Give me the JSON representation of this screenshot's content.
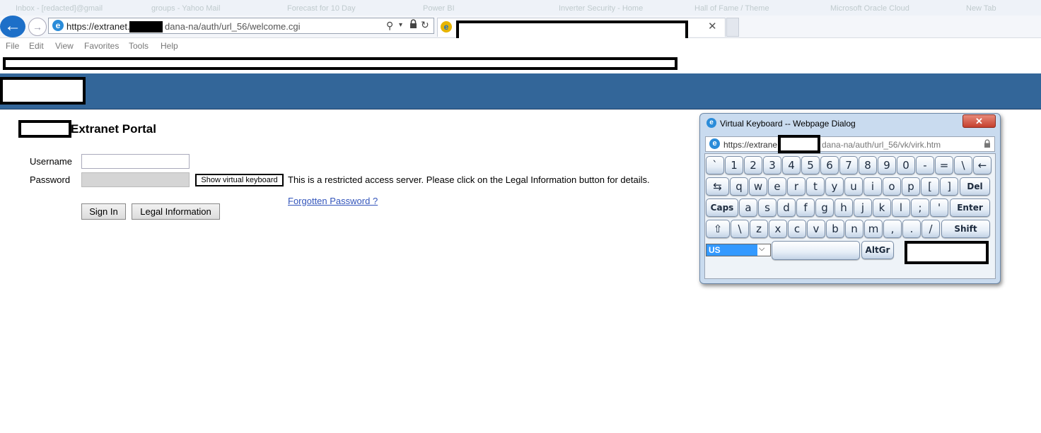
{
  "browser": {
    "faded_tabs": [
      "Inbox - [redacted]@gmail",
      "groups - Yahoo Mail",
      "Forecast for 10 Day",
      "Power BI",
      "Inverter Security - Home",
      "Hall of Fame / Theme",
      "Microsoft Oracle Cloud",
      "New Tab"
    ],
    "address_url_prefix": "https://extranet.r",
    "address_url_suffix": "dana-na/auth/url_56/welcome.cgi",
    "menu": [
      "File",
      "Edit",
      "View",
      "Favorites",
      "Tools",
      "Help"
    ]
  },
  "page": {
    "title": "Extranet Portal",
    "username_label": "Username",
    "password_label": "Password",
    "show_vk_label": "Show virtual keyboard",
    "restricted_text": "This is a restricted access server. Please click on the Legal Information button for details.",
    "forgot_link": "Forgotten Password ?",
    "signin_label": "Sign In",
    "legal_label": "Legal Information"
  },
  "vk_dialog": {
    "title": "Virtual Keyboard -- Webpage Dialog",
    "url_prefix": "https://extrane",
    "url_suffix": "dana-na/auth/url_56/vk/virk.htm",
    "close_label": "✕",
    "rows": [
      [
        "`",
        "1",
        "2",
        "3",
        "4",
        "5",
        "6",
        "7",
        "8",
        "9",
        "0",
        "-",
        "=",
        "\\",
        "←"
      ],
      [
        "⇆",
        "q",
        "w",
        "e",
        "r",
        "t",
        "y",
        "u",
        "i",
        "o",
        "p",
        "[",
        "]",
        "Del"
      ],
      [
        "Caps",
        "a",
        "s",
        "d",
        "f",
        "g",
        "h",
        "j",
        "k",
        "l",
        ";",
        "'",
        "Enter"
      ],
      [
        "⇧",
        "\\",
        "z",
        "x",
        "c",
        "v",
        "b",
        "n",
        "m",
        ",",
        ".",
        "/",
        "Shift"
      ],
      [
        "AltGr"
      ]
    ],
    "language_selected": "US"
  },
  "colors": {
    "banner": "#336699",
    "link": "#3355bb",
    "back_button": "#1d6fc8"
  }
}
